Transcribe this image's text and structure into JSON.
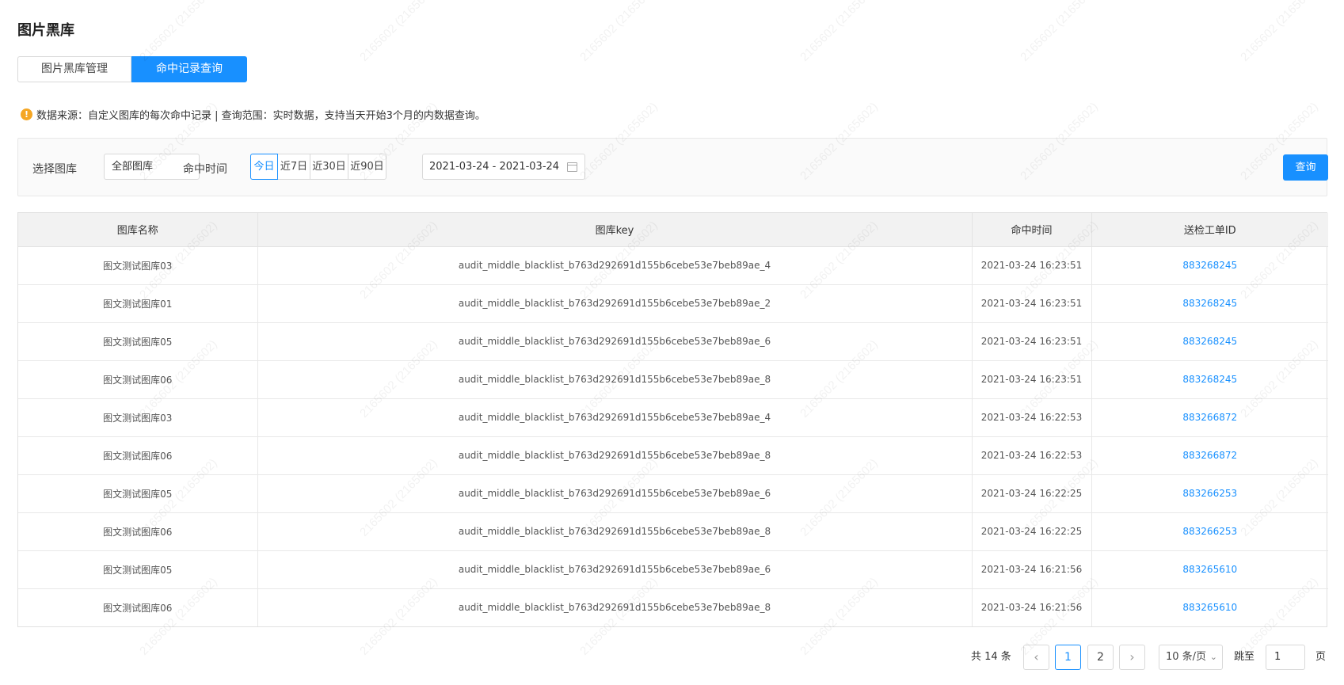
{
  "page": {
    "title": "图片黑库"
  },
  "tabs": [
    {
      "label": "图片黑库管理",
      "active": false
    },
    {
      "label": "命中记录查询",
      "active": true
    }
  ],
  "notice": {
    "text": "数据来源：自定义图库的每次命中记录 | 查询范围：实时数据，支持当天开始3个月的内数据查询。"
  },
  "filters": {
    "library_label": "选择图库",
    "library_value": "全部图库",
    "time_label": "命中时间",
    "time_options": [
      "今日",
      "近7日",
      "近30日",
      "近90日"
    ],
    "time_active": "今日",
    "date_range": "2021-03-24 - 2021-03-24",
    "query_button": "查询"
  },
  "table": {
    "columns": [
      "图库名称",
      "图库key",
      "命中时间",
      "送检工单ID"
    ],
    "rows": [
      [
        "图文测试图库03",
        "audit_middle_blacklist_b763d292691d155b6cebe53e7beb89ae_4",
        "2021-03-24 16:23:51",
        "883268245"
      ],
      [
        "图文测试图库01",
        "audit_middle_blacklist_b763d292691d155b6cebe53e7beb89ae_2",
        "2021-03-24 16:23:51",
        "883268245"
      ],
      [
        "图文测试图库05",
        "audit_middle_blacklist_b763d292691d155b6cebe53e7beb89ae_6",
        "2021-03-24 16:23:51",
        "883268245"
      ],
      [
        "图文测试图库06",
        "audit_middle_blacklist_b763d292691d155b6cebe53e7beb89ae_8",
        "2021-03-24 16:23:51",
        "883268245"
      ],
      [
        "图文测试图库03",
        "audit_middle_blacklist_b763d292691d155b6cebe53e7beb89ae_4",
        "2021-03-24 16:22:53",
        "883266872"
      ],
      [
        "图文测试图库06",
        "audit_middle_blacklist_b763d292691d155b6cebe53e7beb89ae_8",
        "2021-03-24 16:22:53",
        "883266872"
      ],
      [
        "图文测试图库05",
        "audit_middle_blacklist_b763d292691d155b6cebe53e7beb89ae_6",
        "2021-03-24 16:22:25",
        "883266253"
      ],
      [
        "图文测试图库06",
        "audit_middle_blacklist_b763d292691d155b6cebe53e7beb89ae_8",
        "2021-03-24 16:22:25",
        "883266253"
      ],
      [
        "图文测试图库05",
        "audit_middle_blacklist_b763d292691d155b6cebe53e7beb89ae_6",
        "2021-03-24 16:21:56",
        "883265610"
      ],
      [
        "图文测试图库06",
        "audit_middle_blacklist_b763d292691d155b6cebe53e7beb89ae_8",
        "2021-03-24 16:21:56",
        "883265610"
      ]
    ]
  },
  "pagination": {
    "total_text": "共 14 条",
    "pages": [
      "1",
      "2"
    ],
    "current_page": "1",
    "prev_icon": "‹",
    "next_icon": "›",
    "page_size": "10 条/页",
    "jump_label": "跳至",
    "jump_value": "1",
    "jump_unit": "页"
  },
  "watermark": {
    "text": "2165602 (2165602)"
  },
  "colors": {
    "primary": "#1890ff",
    "warning": "#f5a623"
  }
}
